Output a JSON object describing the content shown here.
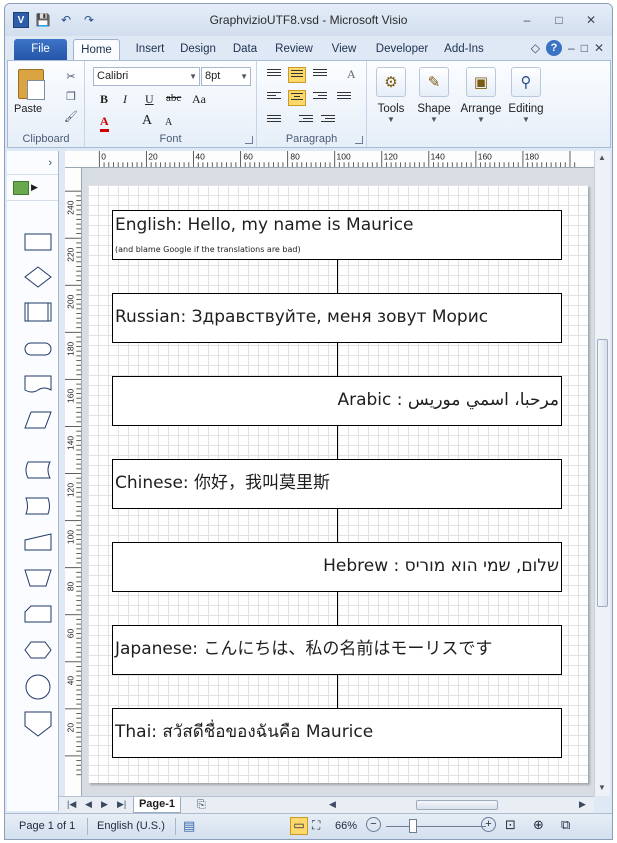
{
  "window": {
    "title": "GraphvizioUTF8.vsd  -  Microsoft Visio",
    "app_icon": "V",
    "controls": [
      "–",
      "□",
      "✕"
    ]
  },
  "qat": {
    "save_icon": "💾",
    "undo_icon": "↶",
    "redo_icon": "↷"
  },
  "ribbon_tabs": [
    "File",
    "Home",
    "Insert",
    "Design",
    "Data",
    "Review",
    "View",
    "Developer",
    "Add-Ins"
  ],
  "ribbon_right": {
    "minimize_icon": "◇",
    "help": "?",
    "sub_min": "–",
    "sub_restore": "□",
    "sub_close": "✕"
  },
  "clipboard": {
    "paste_label": "Paste",
    "group_label": "Clipboard"
  },
  "font": {
    "family": "Calibri",
    "size": "8pt",
    "bold": "B",
    "italic": "I",
    "underline": "U",
    "strike": "abc",
    "case": "Aa",
    "color_glyph": "A",
    "grow": "A",
    "shrink": "A",
    "group_label": "Font",
    "color_hex": "#d00000"
  },
  "paragraph": {
    "group_label": "Paragraph"
  },
  "buttons": {
    "tools": "Tools",
    "shape": "Shape",
    "arrange": "Arrange",
    "editing": "Editing"
  },
  "shapes_panel": {
    "expand_icon": "›"
  },
  "ruler_h": [
    "0",
    "20",
    "40",
    "60",
    "80",
    "100",
    "120",
    "140",
    "160",
    "180"
  ],
  "ruler_v": [
    "240",
    "220",
    "200",
    "180",
    "160",
    "140",
    "120",
    "100",
    "80",
    "60",
    "40",
    "20"
  ],
  "diagram": {
    "boxes": [
      {
        "text": "English: Hello, my name is Maurice",
        "note": "(and blame Google if the translations are bad)",
        "rtl": false
      },
      {
        "text": "Russian: Здравствуйте, меня зовут Морис",
        "note": "",
        "rtl": false
      },
      {
        "text": "مرحبا، اسمي موريس : Arabic",
        "note": "",
        "rtl": true
      },
      {
        "text": "Chinese: 你好，我叫莫里斯",
        "note": "",
        "rtl": false
      },
      {
        "text": "שלום, שמי הוא מוריס : Hebrew",
        "note": "",
        "rtl": true
      },
      {
        "text": "Japanese: こんにちは、私の名前はモーリスです",
        "note": "",
        "rtl": false
      },
      {
        "text": "Thai: สวัสดีชื่อของฉันคือ Maurice",
        "note": "",
        "rtl": false
      }
    ]
  },
  "pagebar": {
    "page_tab": "Page-1",
    "nav_first": "|◀",
    "nav_prev": "◀",
    "nav_next": "▶",
    "nav_last": "▶|"
  },
  "status": {
    "page": "Page 1 of 1",
    "language": "English (U.S.)",
    "zoom": "66%",
    "zoom_out": "−",
    "zoom_in": "+"
  }
}
